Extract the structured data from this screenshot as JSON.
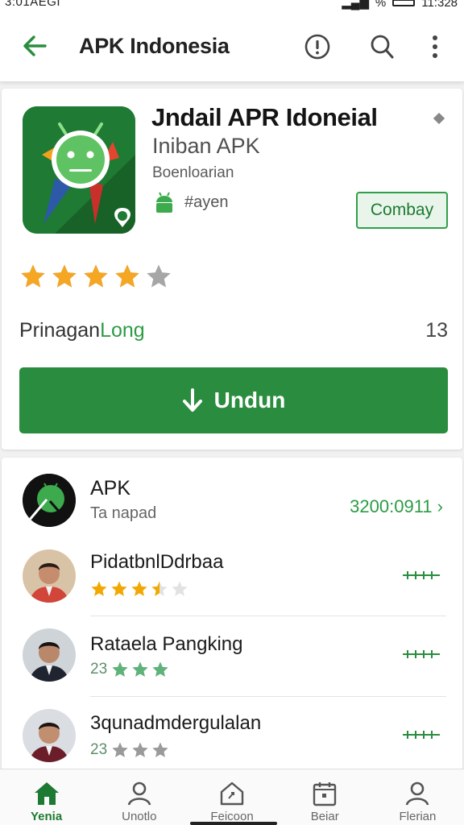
{
  "status_bar": {
    "time_left": "3:01AEGI",
    "time_right": "11:328",
    "battery_label": "%"
  },
  "app_bar": {
    "title": "APK Indonesia",
    "back_icon": "arrow-left-icon",
    "actions": [
      "info-icon",
      "search-icon",
      "more-vert-icon"
    ],
    "accent": "#2a8c3e"
  },
  "detail": {
    "name": "Jndail APR Idoneial",
    "subtitle": "Iniban APK",
    "developer": "Boenloarian",
    "android_label": "#ayen",
    "compat_button": "Combay",
    "rating_stars": 4,
    "rating_max": 5,
    "label_prefix": "Prinagan",
    "label_highlight": "Long",
    "count": "13",
    "download_label": "Undun"
  },
  "list": {
    "top": {
      "name": "APK",
      "sub": "Ta napad",
      "right_text": "3200:0911"
    },
    "reviews": [
      {
        "name": "PidatbnlDdrbaa",
        "stars": 3.5,
        "star_color": "#f2a800",
        "prefix": ""
      },
      {
        "name": "Rataela Pangking",
        "stars": 3,
        "star_color": "#5fb27a",
        "prefix": "23"
      },
      {
        "name": "3qunadmdergulalan",
        "stars": 3,
        "star_color": "#9a9a9a",
        "prefix": "23"
      }
    ]
  },
  "bottom_nav": [
    {
      "label": "Yenia",
      "icon": "home-icon",
      "active": true
    },
    {
      "label": "Unotlo",
      "icon": "person-icon",
      "active": false
    },
    {
      "label": "Feicoon",
      "icon": "home-outline-icon",
      "active": false
    },
    {
      "label": "Beiar",
      "icon": "calendar-icon",
      "active": false
    },
    {
      "label": "Flerian",
      "icon": "account-icon",
      "active": false
    }
  ]
}
